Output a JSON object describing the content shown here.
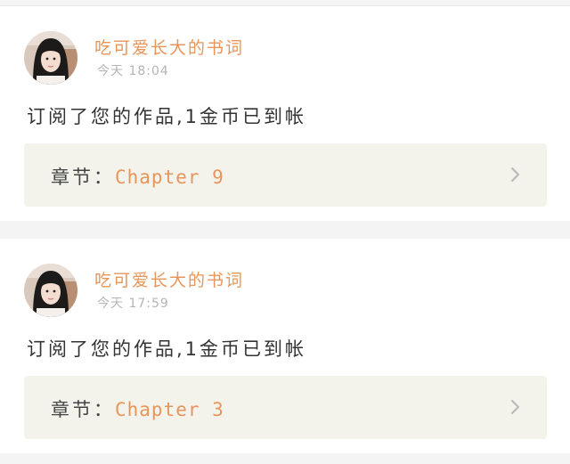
{
  "notifications": [
    {
      "username": "吃可爱长大的书词",
      "timestamp": "今天 18:04",
      "message": "订阅了您的作品,1金币已到帐",
      "chapter_label": "章节：",
      "chapter_value": "Chapter 9"
    },
    {
      "username": "吃可爱长大的书词",
      "timestamp": "今天 17:59",
      "message": "订阅了您的作品,1金币已到帐",
      "chapter_label": "章节：",
      "chapter_value": "Chapter 3"
    }
  ],
  "colors": {
    "accent": "#e8955a",
    "timestamp": "#b5b5b5",
    "chapter_bg": "#f3f3ec",
    "page_bg": "#f4f4f4"
  },
  "icons": {
    "avatar": "user-avatar-photo",
    "chevron": "chevron-right-icon"
  }
}
